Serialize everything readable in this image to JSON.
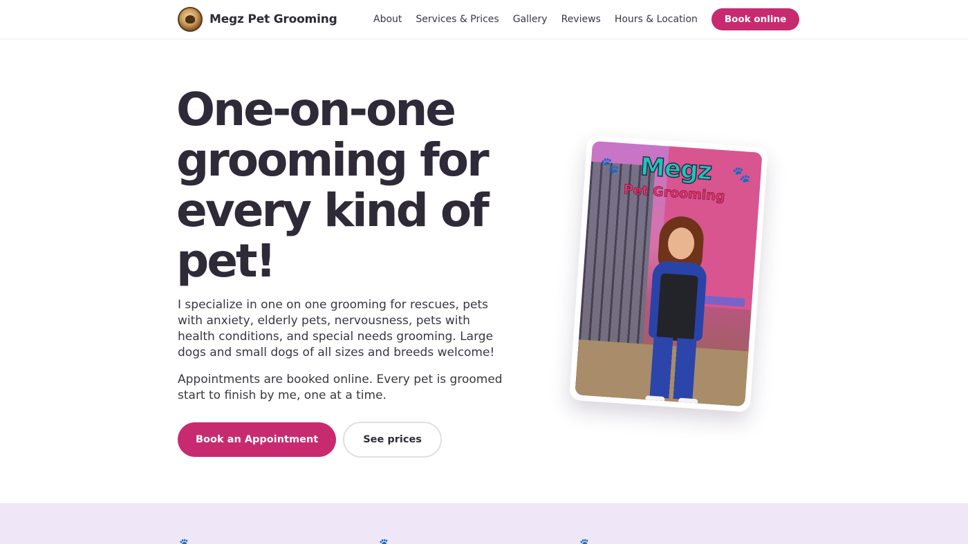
{
  "header": {
    "brand": "Megz Pet Grooming",
    "logo_icon": "shop-logo-icon",
    "nav": [
      {
        "label": "About"
      },
      {
        "label": "Services & Prices"
      },
      {
        "label": "Gallery"
      },
      {
        "label": "Reviews"
      },
      {
        "label": "Hours & Location"
      }
    ],
    "book_label": "Book online"
  },
  "hero": {
    "title": "One-on-one grooming for every kind of pet!",
    "paragraphs": [
      "I specialize in one on one grooming for rescues, pets with anxiety, elderly pets, nervousness, pets with health conditions, and special needs grooming. Large dogs and small dogs of all sizes and breeds welcome!",
      "Appointments are booked online. Every pet is groomed start to finish by me, one at a time."
    ],
    "primary_cta": "Book an Appointment",
    "secondary_cta": "See prices",
    "image": {
      "title": "Megz",
      "subtitle": "Pet Grooming",
      "icons": [
        "paw-print-icon",
        "paw-print-icon"
      ]
    }
  },
  "features": {
    "icons": [
      {
        "name": "paw-print-icon",
        "color": "#c82a6f"
      },
      {
        "name": "paw-print-icon",
        "color": "#7a4fc2"
      },
      {
        "name": "paw-print-icon",
        "color": "#2466b8"
      }
    ]
  },
  "colors": {
    "accent": "#c82a6f",
    "text": "#2f2a38",
    "strip_background": "#efe7f8"
  }
}
